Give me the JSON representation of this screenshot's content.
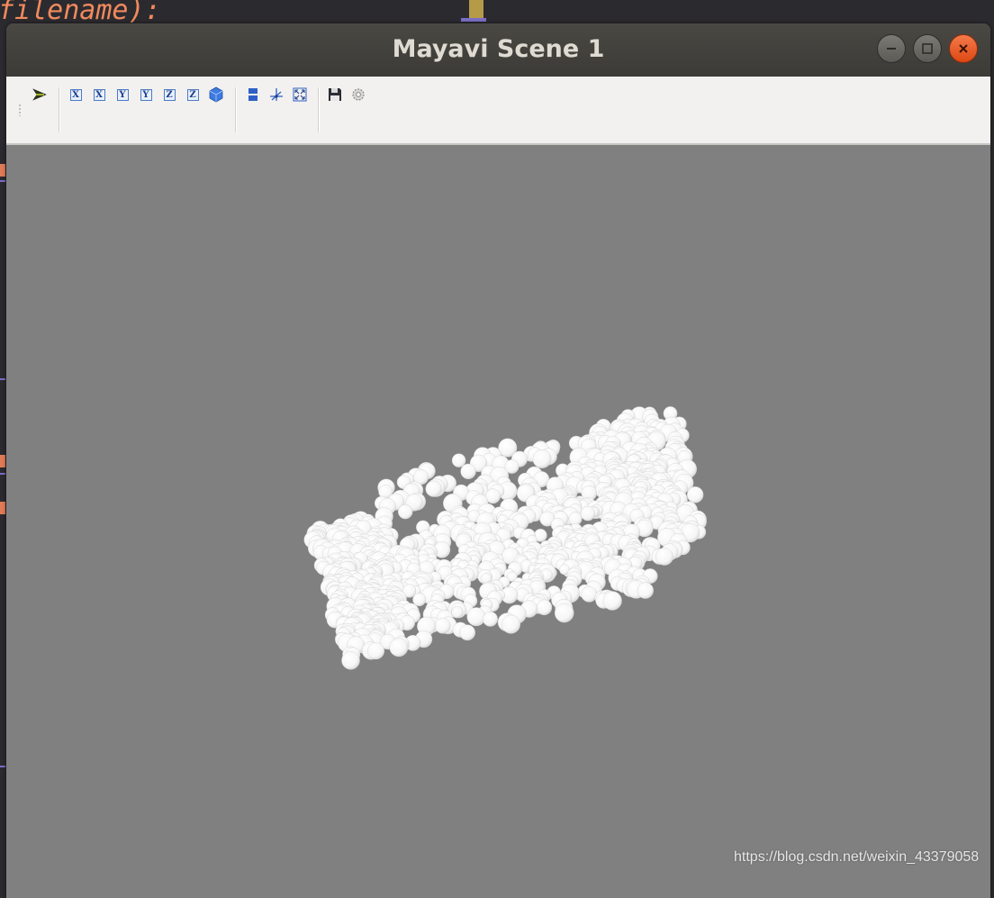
{
  "background": {
    "code_fragment": "filename):"
  },
  "window": {
    "title": "Mayavi Scene 1",
    "controls": [
      "minimize-icon",
      "maximize-icon",
      "close-icon"
    ]
  },
  "toolbar": {
    "groups": [
      [
        "pick-arrow-icon"
      ],
      [
        "view-x-positive-icon",
        "view-x-negative-icon",
        "view-y-positive-icon",
        "view-y-negative-icon",
        "view-z-positive-icon",
        "view-z-negative-icon",
        "isometric-view-icon"
      ],
      [
        "parallel-projection-icon",
        "axes-indicator-icon",
        "full-screen-icon"
      ],
      [
        "save-icon",
        "configure-scene-icon"
      ]
    ],
    "axis_labels": [
      "X",
      "X",
      "Y",
      "Y",
      "Z",
      "Z"
    ]
  },
  "scene": {
    "background_color": "#808080",
    "object": "sofa-point-cloud",
    "point_color": "#ffffff"
  },
  "watermark": "https://blog.csdn.net/weixin_43379058"
}
